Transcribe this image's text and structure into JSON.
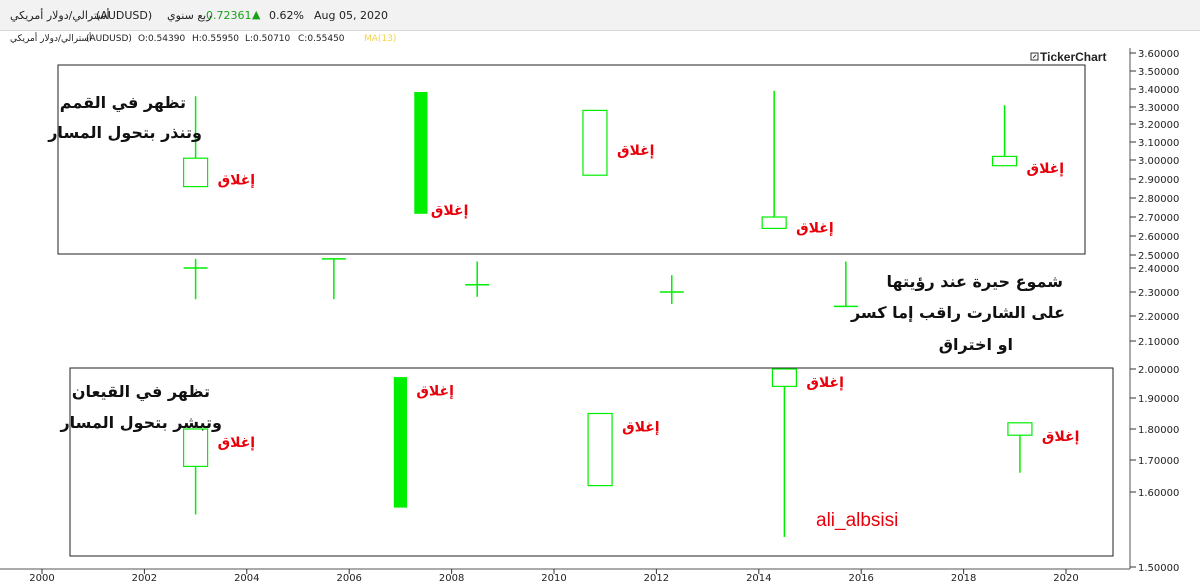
{
  "header": {
    "symbol_name": "أسترالي/دولار أمريكي",
    "symbol_code": "(AUDUSD)",
    "period": "ربع سنوي",
    "price": "0.72361",
    "change_pct": "0.62%",
    "date": "Aug 05, 2020"
  },
  "ohlc_bar": {
    "symbol_name": "أسترالي/دولار أمريكي",
    "symbol_code": "(AUDUSD)",
    "o": "O:0.54390",
    "h": "H:0.55950",
    "l": "L:0.50710",
    "c": "C:0.55450",
    "ma": "MA(13)"
  },
  "brand": "TickerChart",
  "colors": {
    "candle": "#00ee00",
    "annotation": "#e8000a",
    "text": "#111111",
    "up_arrow": "#1aa01a"
  },
  "chart_data": {
    "type": "candlestick",
    "xlim": [
      2000,
      2021.5
    ],
    "ylim": [
      1.5,
      3.65
    ],
    "x_ticks": [
      "2000",
      "2002",
      "2004",
      "2006",
      "2008",
      "2010",
      "2012",
      "2014",
      "2016",
      "2018",
      "2020"
    ],
    "y_ticks": [
      "3.60000",
      "3.50000",
      "3.40000",
      "3.30000",
      "3.20000",
      "3.10000",
      "3.00000",
      "2.90000",
      "2.80000",
      "2.70000",
      "2.60000",
      "2.50000",
      "2.40000",
      "2.30000",
      "2.20000",
      "2.10000",
      "2.00000",
      "1.90000",
      "1.80000",
      "1.70000",
      "1.60000",
      "1.50000"
    ],
    "candles": [
      {
        "x": 2003.0,
        "open": 2.86,
        "high": 3.36,
        "low": 2.86,
        "close": 3.01,
        "filled": false,
        "group": "top",
        "label": "إغلاق"
      },
      {
        "x": 2007.4,
        "open": 2.72,
        "high": 3.38,
        "low": 2.72,
        "close": 3.38,
        "filled": true,
        "group": "top",
        "label": "إغلاق"
      },
      {
        "x": 2010.8,
        "open": 2.92,
        "high": 3.28,
        "low": 2.92,
        "close": 3.28,
        "filled": false,
        "group": "top",
        "label": "إغلاق"
      },
      {
        "x": 2014.3,
        "open": 2.64,
        "high": 3.39,
        "low": 2.64,
        "close": 2.7,
        "filled": false,
        "group": "top",
        "label": "إغلاق"
      },
      {
        "x": 2018.8,
        "open": 2.97,
        "high": 3.31,
        "low": 2.97,
        "close": 3.02,
        "filled": false,
        "group": "top",
        "label": "إغلاق"
      },
      {
        "x": 2003.0,
        "open": 1.68,
        "high": 1.8,
        "low": 1.57,
        "close": 1.8,
        "filled": false,
        "group": "bottom",
        "label": "إغلاق"
      },
      {
        "x": 2007.0,
        "open": 1.58,
        "high": 1.97,
        "low": 1.58,
        "close": 1.97,
        "filled": true,
        "group": "bottom",
        "label": "إغلاق"
      },
      {
        "x": 2010.9,
        "open": 1.62,
        "high": 1.85,
        "low": 1.62,
        "close": 1.85,
        "filled": false,
        "group": "bottom",
        "label": "إغلاق"
      },
      {
        "x": 2014.5,
        "open": 1.94,
        "high": 2.0,
        "low": 1.54,
        "close": 2.0,
        "filled": false,
        "group": "bottom",
        "label": "إغلاق"
      },
      {
        "x": 2019.1,
        "open": 1.78,
        "high": 1.82,
        "low": 1.66,
        "close": 1.82,
        "filled": false,
        "group": "bottom",
        "label": "إغلاق"
      }
    ],
    "doji": [
      {
        "x": 2003.0,
        "open": 2.4,
        "high": 2.47,
        "low": 2.27,
        "close": 2.4
      },
      {
        "x": 2005.7,
        "open": 2.47,
        "high": 2.47,
        "low": 2.27,
        "close": 2.47
      },
      {
        "x": 2008.5,
        "open": 2.33,
        "high": 2.45,
        "low": 2.28,
        "close": 2.33
      },
      {
        "x": 2012.3,
        "open": 2.3,
        "high": 2.37,
        "low": 2.25,
        "close": 2.3
      },
      {
        "x": 2015.7,
        "open": 2.24,
        "high": 2.45,
        "low": 2.24,
        "close": 2.24
      }
    ],
    "annotations": {
      "top_box_line1": "تظهر في القمم",
      "top_box_line2": "وتنذر بتحول المسار",
      "bottom_box_line1": "تظهر في القيعان",
      "bottom_box_line2": "وتبشر بتحول المسار",
      "middle_line1": "شموع حيرة عند رؤيتها",
      "middle_line2": "على الشارت راقب إما كسر",
      "middle_line3": "او اختراق",
      "author": "ali_albsisi"
    }
  }
}
